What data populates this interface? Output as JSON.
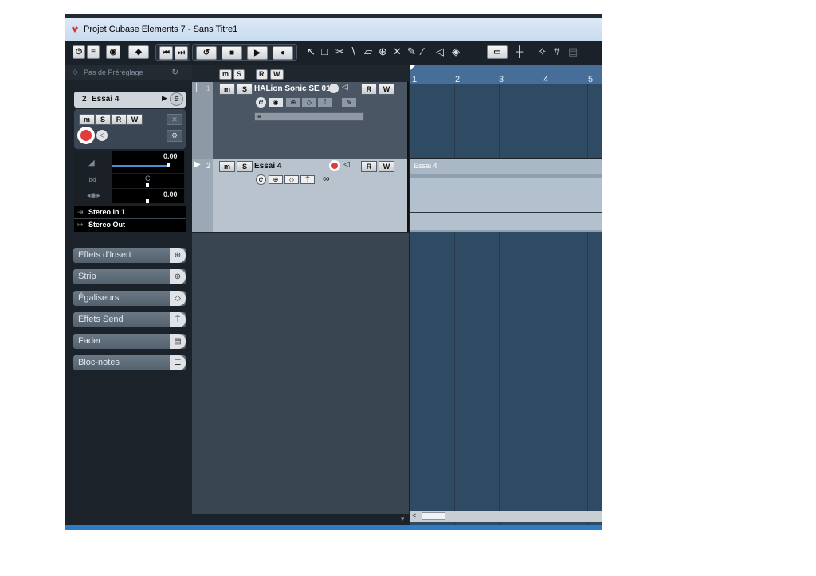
{
  "window": {
    "title": "Projet Cubase Elements 7 - Sans Titre1"
  },
  "colors": {
    "accent": "#2e7cc4",
    "record": "#e23b3b",
    "ruler": "#466e99"
  },
  "toolbar": {
    "icons": [
      "power-icon",
      "list-icon",
      "settings-icon",
      "snap-icon",
      "rewind-start-icon",
      "forward-end-icon",
      "cycle-icon",
      "stop-icon",
      "play-icon",
      "record-icon",
      "pointer-tool-icon",
      "range-tool-icon",
      "split-tool-icon",
      "glue-tool-icon",
      "erase-tool-icon",
      "zoom-tool-icon",
      "mute-tool-icon",
      "draw-tool-icon",
      "line-tool-icon",
      "play-tool-icon",
      "color-tool-icon",
      "grid-icon"
    ]
  },
  "inspector": {
    "preset_label": "Pas de Préréglage",
    "track_number": "2",
    "track_name": "Essai 4",
    "buttons": {
      "mute": "m",
      "solo": "S",
      "read": "R",
      "write": "W"
    },
    "volume_value": "0.00",
    "pan_value": "C",
    "delay_value": "0.00",
    "input_routing": "Stereo In 1",
    "output_routing": "Stereo Out",
    "sections": [
      {
        "label": "Effets d'Insert",
        "icon": "insert-icon"
      },
      {
        "label": "Strip",
        "icon": "strip-icon"
      },
      {
        "label": "Égaliseurs",
        "icon": "eq-icon"
      },
      {
        "label": "Effets Send",
        "icon": "send-icon"
      },
      {
        "label": "Fader",
        "icon": "fader-icon"
      },
      {
        "label": "Bloc-notes",
        "icon": "notepad-icon"
      }
    ]
  },
  "track_header": {
    "global_buttons": [
      "m",
      "S",
      "R",
      "W"
    ],
    "tracks": [
      {
        "number": "1",
        "name": "HALion Sonic SE 01",
        "mute": "m",
        "solo": "S",
        "read": "R",
        "write": "W"
      },
      {
        "number": "2",
        "name": "Essai 4",
        "mute": "m",
        "solo": "S",
        "read": "R",
        "write": "W"
      }
    ]
  },
  "project": {
    "ruler_marks": [
      "1",
      "2",
      "3",
      "4",
      "5"
    ],
    "event_name": "Essai 4"
  }
}
